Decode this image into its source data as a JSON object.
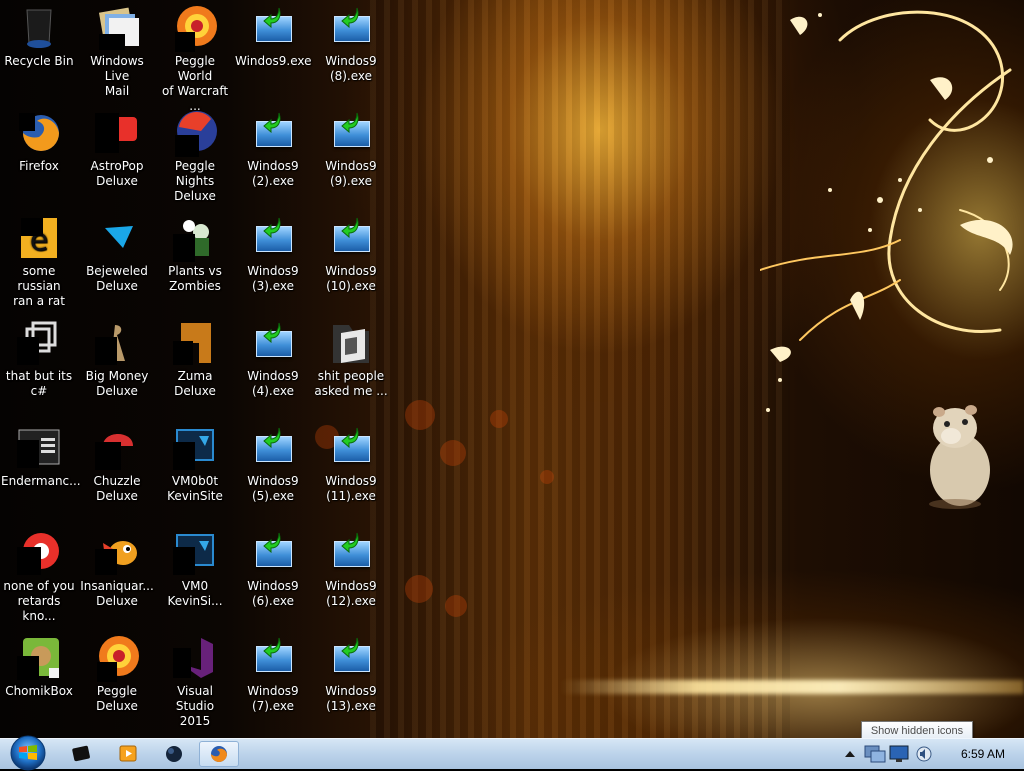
{
  "desktop": {
    "icons": [
      {
        "label": "Recycle Bin",
        "icon": "recycle-bin-icon"
      },
      {
        "label": "Windows Live\nMail",
        "icon": "mail-icon"
      },
      {
        "label": "Peggle World\nof Warcraft ...",
        "icon": "peggle-icon"
      },
      {
        "label": "Windos9.exe",
        "icon": "installer-exe-icon"
      },
      {
        "label": "Windos9\n(8).exe",
        "icon": "installer-exe-icon"
      },
      {
        "label": "Firefox",
        "icon": "firefox-icon"
      },
      {
        "label": "AstroPop\nDeluxe",
        "icon": "astropop-icon"
      },
      {
        "label": "Peggle Nights\nDeluxe",
        "icon": "peggle-nights-icon"
      },
      {
        "label": "Windos9\n(2).exe",
        "icon": "installer-exe-icon"
      },
      {
        "label": "Windos9\n(9).exe",
        "icon": "installer-exe-icon"
      },
      {
        "label": "some russian\nran a rat",
        "icon": "document-icon"
      },
      {
        "label": "Bejeweled\nDeluxe",
        "icon": "bejeweled-icon"
      },
      {
        "label": "Plants vs\nZombies",
        "icon": "plants-vs-zombies-icon"
      },
      {
        "label": "Windos9\n(3).exe",
        "icon": "installer-exe-icon"
      },
      {
        "label": "Windos9\n(10).exe",
        "icon": "installer-exe-icon"
      },
      {
        "label": "that but its c#",
        "icon": "window-stack-icon"
      },
      {
        "label": "Big Money\nDeluxe",
        "icon": "big-money-icon"
      },
      {
        "label": "Zuma Deluxe",
        "icon": "zuma-icon"
      },
      {
        "label": "Windos9\n(4).exe",
        "icon": "installer-exe-icon"
      },
      {
        "label": "shit people\nasked me ...",
        "icon": "folder-icon"
      },
      {
        "label": "Endermanc...",
        "icon": "terminal-icon"
      },
      {
        "label": "Chuzzle\nDeluxe",
        "icon": "chuzzle-icon"
      },
      {
        "label": "VM0b0t\nKevinSite",
        "icon": "vm-icon"
      },
      {
        "label": "Windos9\n(5).exe",
        "icon": "installer-exe-icon"
      },
      {
        "label": "Windos9\n(11).exe",
        "icon": "installer-exe-icon"
      },
      {
        "label": "none of you\nretards kno...",
        "icon": "chrome-like-icon"
      },
      {
        "label": "Insaniquar...\nDeluxe",
        "icon": "insaniquarium-icon"
      },
      {
        "label": "VM0\nKevinSi...",
        "icon": "vm-icon"
      },
      {
        "label": "Windos9\n(6).exe",
        "icon": "installer-exe-icon"
      },
      {
        "label": "Windos9\n(12).exe",
        "icon": "installer-exe-icon"
      },
      {
        "label": "ChomikBox",
        "icon": "chomikbox-icon"
      },
      {
        "label": "Peggle Deluxe",
        "icon": "peggle-icon"
      },
      {
        "label": "Visual Studio\n2015",
        "icon": "visual-studio-icon"
      },
      {
        "label": "Windos9\n(7).exe",
        "icon": "installer-exe-icon"
      },
      {
        "label": "Windos9\n(13).exe",
        "icon": "installer-exe-icon"
      }
    ]
  },
  "taskbar": {
    "start": "start-orb-icon",
    "pinned": [
      {
        "name": "cmd-icon",
        "active": false
      },
      {
        "name": "media-player-icon",
        "active": false
      },
      {
        "name": "ball-app-icon",
        "active": false
      },
      {
        "name": "firefox-icon",
        "active": true
      }
    ],
    "tray": {
      "tooltip": "Show hidden icons",
      "clock": "6:59 AM"
    }
  },
  "colors": {
    "taskbar": "#bcd3ea",
    "accent_gold": "#f0a020",
    "exe_blue": "#3f8fd8",
    "exe_arrow_green": "#22cc22"
  }
}
